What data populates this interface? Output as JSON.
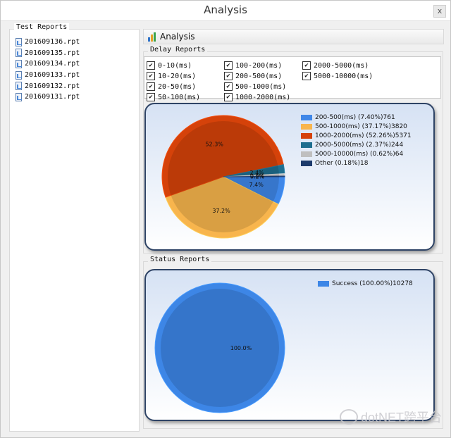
{
  "window": {
    "title": "Analysis",
    "close_symbol": "x"
  },
  "test_reports": {
    "title": "Test Reports",
    "files": [
      "201609136.rpt",
      "201609135.rpt",
      "201609134.rpt",
      "201609133.rpt",
      "201609132.rpt",
      "201609131.rpt"
    ]
  },
  "toolbar": {
    "analysis_label": "Analysis"
  },
  "delay_reports": {
    "title": "Delay  Reports",
    "filters": [
      {
        "label": "0-10(ms)",
        "checked": true
      },
      {
        "label": "10-20(ms)",
        "checked": true
      },
      {
        "label": "20-50(ms)",
        "checked": true
      },
      {
        "label": "50-100(ms)",
        "checked": true
      },
      {
        "label": "100-200(ms)",
        "checked": true
      },
      {
        "label": "200-500(ms)",
        "checked": true
      },
      {
        "label": "500-1000(ms)",
        "checked": true
      },
      {
        "label": "1000-2000(ms)",
        "checked": true
      },
      {
        "label": "2000-5000(ms)",
        "checked": true
      },
      {
        "label": "5000-10000(ms)",
        "checked": true
      }
    ]
  },
  "status_reports": {
    "title": "Status Reports"
  },
  "watermark": {
    "text": "dotNET跨平台"
  },
  "chart_data": [
    {
      "type": "pie",
      "series": [
        {
          "legend": "200-500(ms) (7.40%)761",
          "percent_label": "7.4%",
          "value": 761,
          "color": "#3f87e8"
        },
        {
          "legend": "500-1000(ms) (37.17%)3820",
          "percent_label": "37.2%",
          "value": 3820,
          "color": "#f8b54d"
        },
        {
          "legend": "1000-2000(ms) (52.26%)5371",
          "percent_label": "52.3%",
          "value": 5371,
          "color": "#d5420a"
        },
        {
          "legend": "2000-5000(ms) (2.37%)244",
          "percent_label": "2.4%",
          "value": 244,
          "color": "#1e6e8f"
        },
        {
          "legend": "5000-10000(ms) (0.62%)64",
          "percent_label": "0.6%",
          "value": 64,
          "color": "#bfbfbf"
        },
        {
          "legend": "Other (0.18%)18",
          "percent_label": "0.2%",
          "value": 18,
          "color": "#1c3a6b"
        }
      ]
    },
    {
      "type": "pie",
      "series": [
        {
          "legend": "Success (100.00%)10278",
          "percent_label": "100.0%",
          "value": 10278,
          "color": "#3d86e6"
        }
      ]
    }
  ]
}
